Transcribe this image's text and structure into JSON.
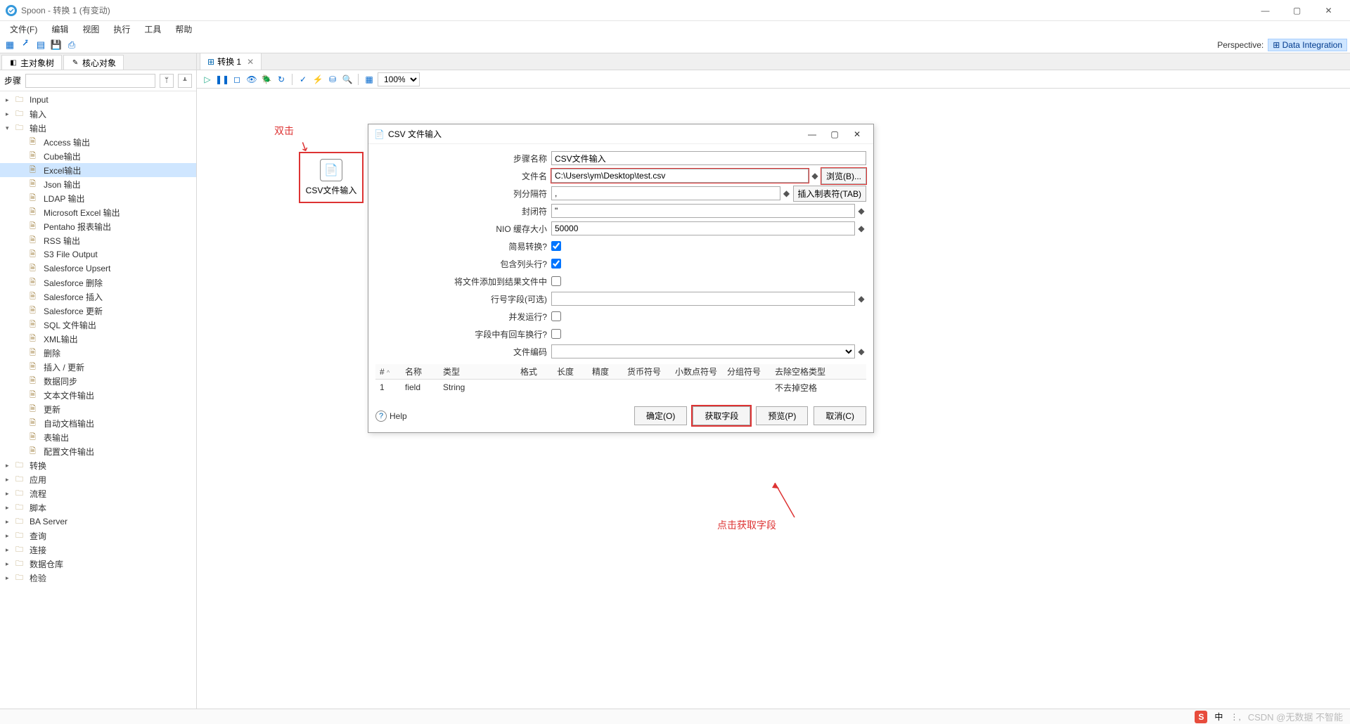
{
  "window": {
    "title": "Spoon - 转换 1 (有变动)"
  },
  "menu": {
    "file": "文件(F)",
    "edit": "编辑",
    "view": "视图",
    "run": "执行",
    "tools": "工具",
    "help": "帮助"
  },
  "perspective": {
    "label": "Perspective:",
    "value": "Data Integration"
  },
  "left_tabs": {
    "main_tree": "主对象树",
    "core": "核心对象"
  },
  "steps": {
    "label": "步骤"
  },
  "tree": {
    "input_en": "Input",
    "input": "输入",
    "output": "输出",
    "out_items": [
      "Access 输出",
      "Cube输出",
      "Excel输出",
      "Json 输出",
      "LDAP 输出",
      "Microsoft Excel 输出",
      "Pentaho 报表输出",
      "RSS 输出",
      "S3 File Output",
      "Salesforce Upsert",
      "Salesforce 删除",
      "Salesforce 插入",
      "Salesforce 更新",
      "SQL 文件输出",
      "XML输出",
      "删除",
      "插入 / 更新",
      "数据同步",
      "文本文件输出",
      "更新",
      "自动文档输出",
      "表输出",
      "配置文件输出"
    ],
    "folders": [
      "转换",
      "应用",
      "流程",
      "脚本",
      "BA Server",
      "查询",
      "连接",
      "数据仓库",
      "检验"
    ]
  },
  "canvas": {
    "tab": "转换 1",
    "zoom": "100%",
    "step_label": "CSV文件输入",
    "ann_dblclick": "双击"
  },
  "dialog": {
    "title": "CSV 文件输入",
    "labels": {
      "step_name": "步骤名称",
      "file_name": "文件名",
      "delimiter": "列分隔符",
      "enclosure": "封闭符",
      "nio": "NIO 缓存大小",
      "lazy": "简易转换?",
      "header": "包含列头行?",
      "addfile": "将文件添加到结果文件中",
      "rownum": "行号字段(可选)",
      "parallel": "并发运行?",
      "newline": "字段中有回车换行?",
      "encoding": "文件编码"
    },
    "values": {
      "step_name": "CSV文件输入",
      "file_name": "C:\\Users\\ym\\Desktop\\test.csv",
      "delimiter": ",",
      "enclosure": "\"",
      "nio": "50000",
      "lazy": true,
      "header": true,
      "addfile": false,
      "rownum": "",
      "parallel": false,
      "newline": false,
      "encoding": ""
    },
    "browse": "浏览(B)...",
    "insert_tab": "插入制表符(TAB)",
    "grid": {
      "headers": {
        "num": "#",
        "name": "名称",
        "type": "类型",
        "format": "格式",
        "length": "长度",
        "precision": "精度",
        "currency": "货币符号",
        "decimal": "小数点符号",
        "group": "分组符号",
        "trim": "去除空格类型"
      },
      "rows": [
        {
          "num": "1",
          "name": "field",
          "type": "String",
          "trim": "不去掉空格"
        }
      ]
    },
    "buttons": {
      "help": "Help",
      "ok": "确定(O)",
      "get": "获取字段",
      "preview": "预览(P)",
      "cancel": "取消(C)"
    }
  },
  "ann_click_get": "点击获取字段",
  "status": {
    "ime": "中",
    "wm": "CSDN @无数据 不智能"
  }
}
